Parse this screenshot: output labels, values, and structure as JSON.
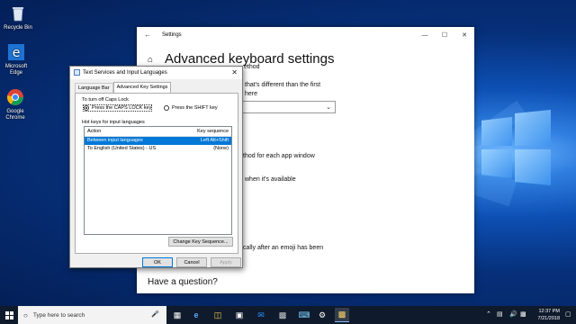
{
  "desktop": {
    "icons": [
      {
        "label": "Recycle Bin"
      },
      {
        "label": "Microsoft Edge"
      },
      {
        "label": "Google Chrome"
      }
    ]
  },
  "settings": {
    "window_title": "Settings",
    "heading": "Advanced keyboard settings",
    "fragments": [
      "ethod",
      "that's different than the first",
      "here",
      "thod for each app window",
      "when it's available",
      "cally after an emoji has been"
    ],
    "question": "Have a question?"
  },
  "dialog": {
    "title": "Text Services and Input Languages",
    "tabs": [
      "Language Bar",
      "Advanced Key Settings"
    ],
    "active_tab": "Advanced Key Settings",
    "caps_group_label": "To turn off Caps Lock",
    "radio_caps": "Press the CAPS LOCK key",
    "radio_shift": "Press the SHIFT key",
    "hotkeys_label": "Hot keys for input languages",
    "col_action": "Action",
    "col_sequence": "Key sequence",
    "rows": [
      {
        "action": "Between input languages",
        "sequence": "Left Alt+Shift"
      },
      {
        "action": "To English (United States) - US",
        "sequence": "(None)"
      }
    ],
    "change_btn": "Change Key Sequence...",
    "ok": "OK",
    "cancel": "Cancel",
    "apply": "Apply"
  },
  "taskbar": {
    "search_placeholder": "Type here to search",
    "time": "12:37 PM",
    "date": "7/21/2018"
  }
}
